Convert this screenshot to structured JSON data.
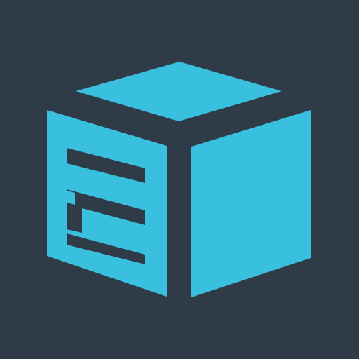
{
  "icon": {
    "name": "cube-document-logo-icon",
    "background_color": "#2f3b47",
    "accent_color": "#38c0de"
  }
}
